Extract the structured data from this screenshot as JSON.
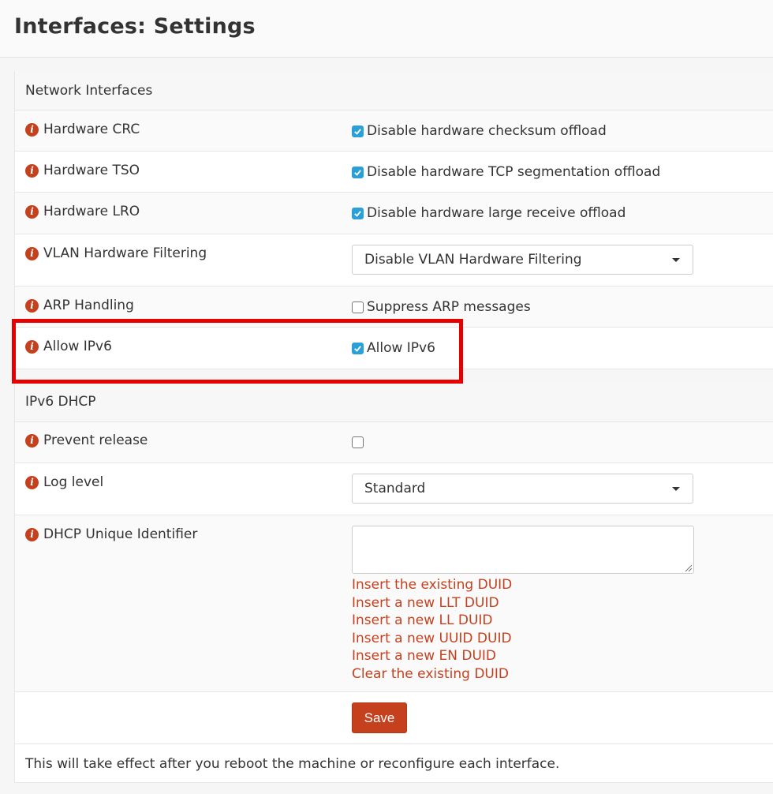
{
  "page": {
    "title": "Interfaces: Settings"
  },
  "sections": {
    "network": {
      "title": "Network Interfaces",
      "rows": [
        {
          "label": "Hardware CRC",
          "control": "checkbox",
          "checked": true,
          "text": "Disable hardware checksum offload"
        },
        {
          "label": "Hardware TSO",
          "control": "checkbox",
          "checked": true,
          "text": "Disable hardware TCP segmentation offload"
        },
        {
          "label": "Hardware LRO",
          "control": "checkbox",
          "checked": true,
          "text": "Disable hardware large receive offload"
        },
        {
          "label": "VLAN Hardware Filtering",
          "control": "select",
          "value": "Disable VLAN Hardware Filtering"
        },
        {
          "label": "ARP Handling",
          "control": "checkbox",
          "checked": false,
          "text": "Suppress ARP messages"
        },
        {
          "label": "Allow IPv6",
          "control": "checkbox",
          "checked": true,
          "text": "Allow IPv6"
        }
      ]
    },
    "ipv6dhcp": {
      "title": "IPv6 DHCP",
      "rows": [
        {
          "label": "Prevent release",
          "control": "checkbox",
          "checked": false
        },
        {
          "label": "Log level",
          "control": "select",
          "value": "Standard"
        },
        {
          "label": "DHCP Unique Identifier",
          "control": "textarea",
          "value": "",
          "links": [
            "Insert the existing DUID",
            "Insert a new LLT DUID",
            "Insert a new LL DUID",
            "Insert a new UUID DUID",
            "Insert a new EN DUID",
            "Clear the existing DUID"
          ]
        }
      ]
    }
  },
  "save_label": "Save",
  "note": "This will take effect after you reboot the machine or reconfigure each interface.",
  "icons": {
    "info": "info-icon",
    "checkmark": "check-icon",
    "dropdown": "chevron-down-icon"
  },
  "colors": {
    "accent": "#c5411e",
    "checkbox": "#2a9fd8",
    "highlight": "#e60000"
  }
}
